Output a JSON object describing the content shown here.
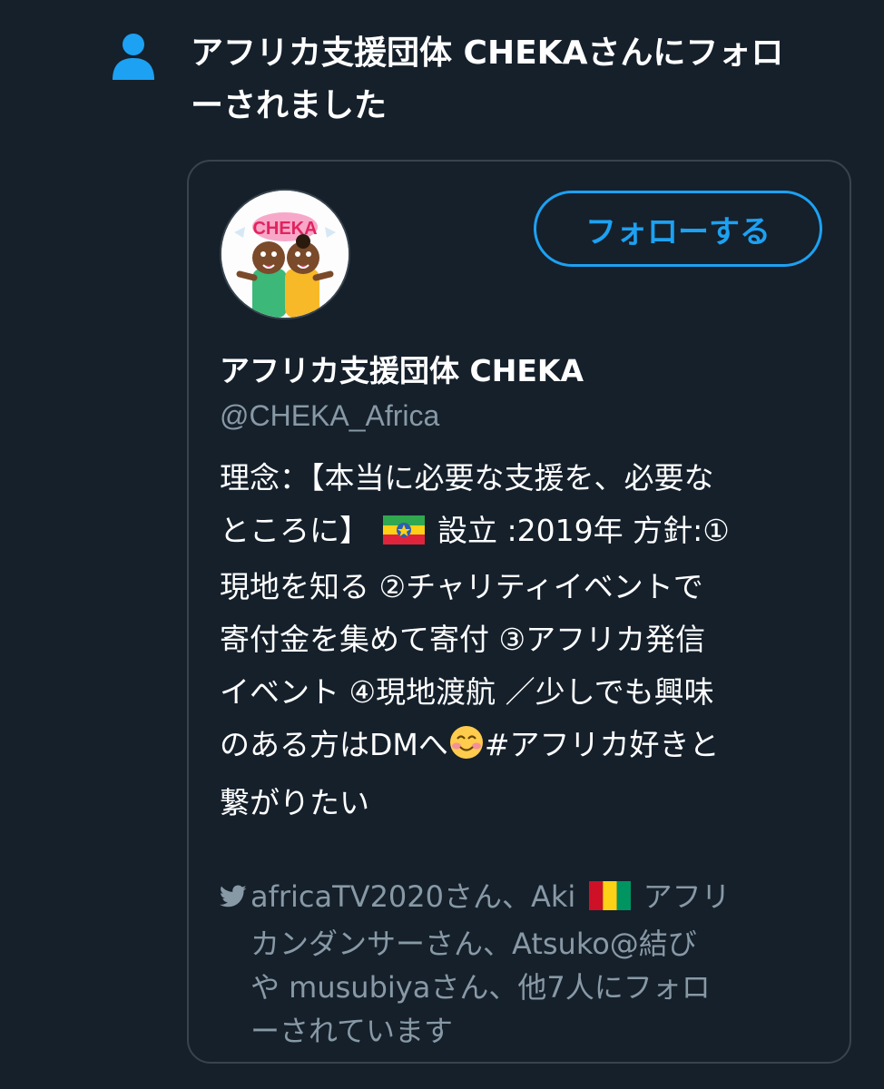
{
  "notification": {
    "icon": "person-icon",
    "line1": "アフリカ支援団体 CHEKAさんにフォロ",
    "line2": "ーされました"
  },
  "colors": {
    "background": "#15202b",
    "accent": "#1da1f2",
    "muted": "#8899a6",
    "border": "#38444d"
  },
  "card": {
    "avatar_logo_text": "CHEKA",
    "follow_button_label": "フォローする",
    "display_name": "アフリカ支援団体 CHEKA",
    "handle": "@CHEKA_Africa",
    "bio": {
      "line1": "理念：【本当に必要な支援を、必要な",
      "line2a": "ところに】",
      "flag1": "ethiopia-flag",
      "line2b": "設立 :2019年 方針:①",
      "line3": "現地を知る ②チャリティイベントで",
      "line4": "寄付金を集めて寄付 ③アフリカ発信",
      "line5": "イベント ④現地渡航 ／少しでも興味",
      "line6a": "のある方はDMへ",
      "emoji": "smiling-face-emoji",
      "line6b": "#アフリカ好きと",
      "line7": "繋がりたい"
    },
    "followed_by": {
      "icon": "twitter-bird-icon",
      "line1a": "africaTV2020さん、Aki",
      "flag2": "guinea-flag",
      "line1b": "アフリ",
      "line2": "カンダンサーさん、Atsuko@結び",
      "line3": "や musubiyaさん、他7人にフォロ",
      "line4": "ーされています"
    }
  }
}
